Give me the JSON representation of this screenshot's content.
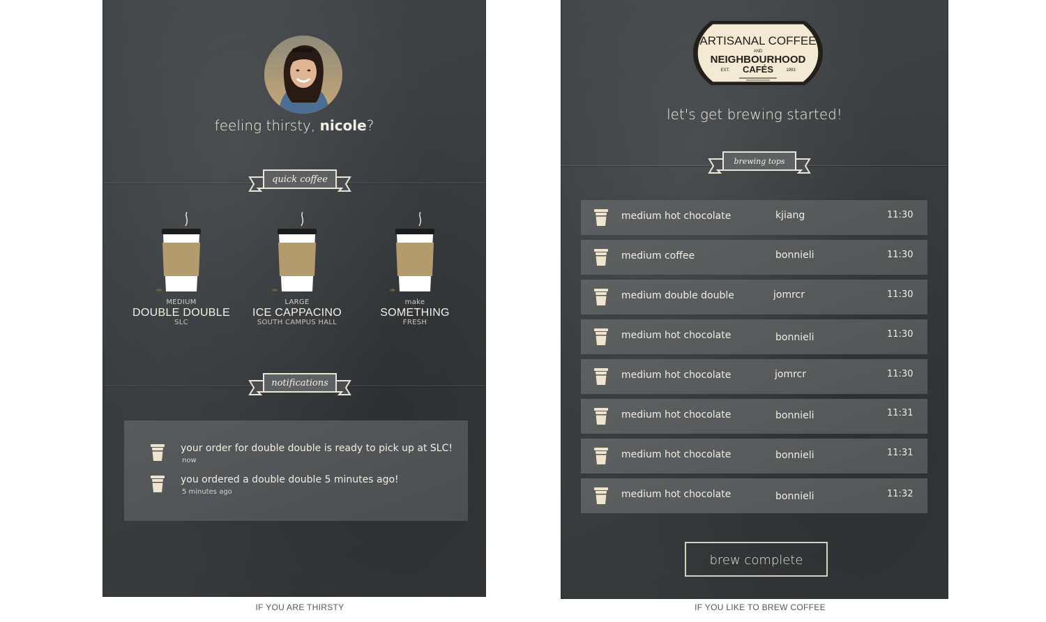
{
  "thirsty_screen": {
    "greeting_prefix": "feeling thirsty, ",
    "user_name": "nicole",
    "greeting_suffix": "?",
    "quick_coffee_label": "quick coffee",
    "notifications_label": "notifications",
    "quick_items": [
      {
        "size": "MEDIUM",
        "name": "DOUBLE DOUBLE",
        "location": "SLC"
      },
      {
        "size": "LARGE",
        "name": "ICE CAPPACINO",
        "location": "SOUTH CAMPUS HALL"
      },
      {
        "size": "make",
        "name": "SOMETHING",
        "location": "FRESH"
      }
    ],
    "notifications": [
      {
        "text": "your order for double double is ready to pick up at SLC!",
        "time": "now"
      },
      {
        "text": "you ordered a double double 5 minutes ago!",
        "time": "5 minutes ago"
      }
    ],
    "caption": "IF YOU ARE THIRSTY"
  },
  "brew_screen": {
    "logo": {
      "line1": "ARTISANAL COFFEE",
      "and": "AND",
      "line2": "NEIGHBOURHOOD",
      "est": "EST.",
      "cafes": "CAFÉS",
      "year": "1993"
    },
    "subtitle": "let's get brewing started!",
    "brewing_label": "brewing tops",
    "orders": [
      {
        "item": "medium hot chocolate",
        "user": "kjiang",
        "time": "11:30"
      },
      {
        "item": "medium coffee",
        "user": "bonnieli",
        "time": "11:30"
      },
      {
        "item": "medium double double",
        "user": "jomrcr",
        "time": "11:30"
      },
      {
        "item": "medium hot chocolate",
        "user": "bonnieli",
        "time": "11:30"
      },
      {
        "item": "medium hot chocolate",
        "user": "jomrcr",
        "time": "11:30"
      },
      {
        "item": "medium hot chocolate",
        "user": "bonnieli",
        "time": "11:31"
      },
      {
        "item": "medium hot chocolate",
        "user": "bonnieli",
        "time": "11:31"
      },
      {
        "item": "medium hot chocolate",
        "user": "bonnieli",
        "time": "11:32"
      }
    ],
    "button_label": "brew complete",
    "caption": "IF YOU LIKE TO BREW COFFEE"
  },
  "icons": {
    "cup": "coffee-cup-icon",
    "steam": "steam-icon",
    "banner": "ribbon-banner"
  },
  "colors": {
    "background": "#3b3f41",
    "panel": "#555859",
    "cream": "#f3eee6",
    "sleeve": "#b39b6e",
    "logo_bg": "#f4ead4"
  }
}
